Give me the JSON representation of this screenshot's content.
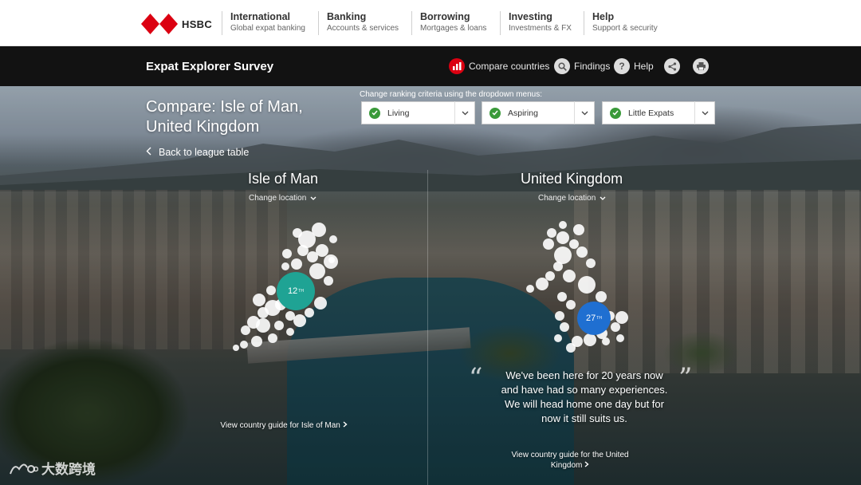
{
  "brand": {
    "name": "HSBC",
    "red": "#db0011"
  },
  "nav": [
    {
      "title": "International",
      "subtitle": "Global expat banking"
    },
    {
      "title": "Banking",
      "subtitle": "Accounts & services"
    },
    {
      "title": "Borrowing",
      "subtitle": "Mortgages & loans"
    },
    {
      "title": "Investing",
      "subtitle": "Investments & FX"
    },
    {
      "title": "Help",
      "subtitle": "Support & security"
    }
  ],
  "survey_bar": {
    "title": "Expat Explorer Survey",
    "compare": {
      "label": "Compare countries",
      "icon": "bar-chart-icon"
    },
    "findings": {
      "label": "Findings",
      "icon": "search-icon"
    },
    "help": {
      "label": "Help",
      "icon": "question-icon"
    },
    "share_icon": "share-icon",
    "print_icon": "print-icon"
  },
  "compare": {
    "title": "Compare: Isle of Man, United Kingdom",
    "back_label": "Back to league table"
  },
  "criteria": {
    "label": "Change ranking criteria using the dropdown menus:",
    "dropdowns": [
      {
        "value": "Living"
      },
      {
        "value": "Aspiring"
      },
      {
        "value": "Little Expats"
      }
    ],
    "check_color": "#3a9a3a"
  },
  "locations": [
    {
      "name": "Isle of Man",
      "change_label": "Change location",
      "rank_number": "12",
      "rank_suffix": "TH",
      "rank_color": "#1fa394",
      "guide": "View country guide for Isle of Man"
    },
    {
      "name": "United Kingdom",
      "change_label": "Change location",
      "rank_number": "27",
      "rank_suffix": "TH",
      "rank_color": "#1f6fd1",
      "guide": "View country guide for the United Kingdom"
    }
  ],
  "quote": {
    "text": "We've been here for 20 years now and have had so many experiences. We will head home one day but for now it still suits us.",
    "open_mark": "“",
    "close_mark": "”"
  },
  "watermark": "大数跨境"
}
